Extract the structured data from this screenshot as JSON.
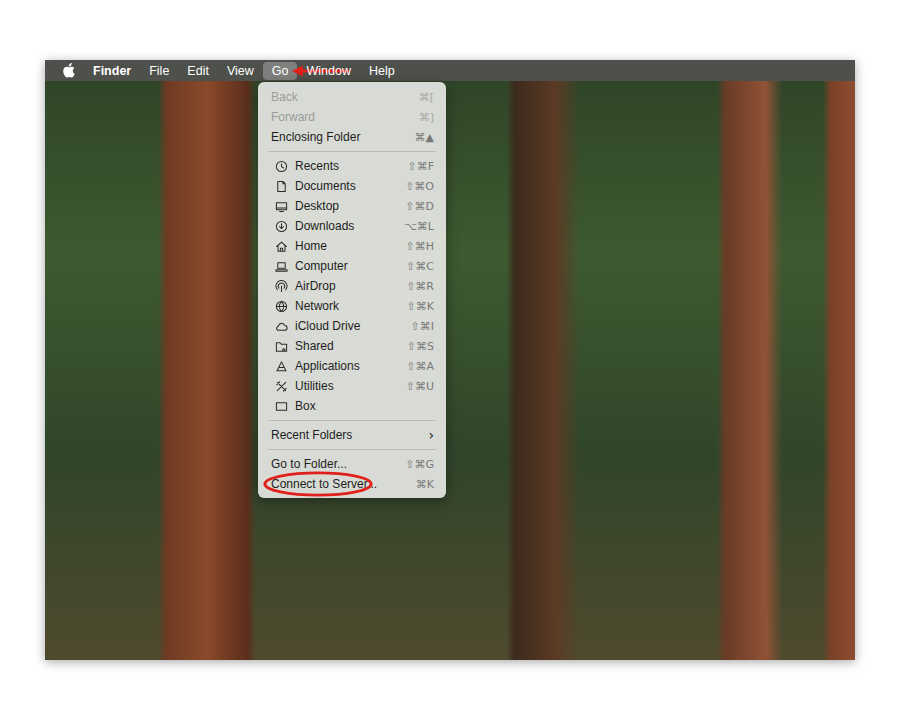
{
  "menu_bar": {
    "items": [
      {
        "label": "Finder",
        "kind": "app",
        "selected": false,
        "annotated": false
      },
      {
        "label": "File",
        "kind": "menu",
        "selected": false,
        "annotated": false
      },
      {
        "label": "Edit",
        "kind": "menu",
        "selected": false,
        "annotated": false
      },
      {
        "label": "View",
        "kind": "menu",
        "selected": false,
        "annotated": false
      },
      {
        "label": "Go",
        "kind": "menu",
        "selected": true,
        "annotated": true
      },
      {
        "label": "Window",
        "kind": "menu",
        "selected": false,
        "annotated": false
      },
      {
        "label": "Help",
        "kind": "menu",
        "selected": false,
        "annotated": false
      }
    ]
  },
  "menu": {
    "groups": [
      {
        "items": [
          {
            "label": "Back",
            "shortcut": "⌘[",
            "kind": "plain",
            "disabled": true,
            "circled": false
          },
          {
            "label": "Forward",
            "shortcut": "⌘]",
            "kind": "plain",
            "disabled": true,
            "circled": false
          },
          {
            "label": "Enclosing Folder",
            "shortcut": "⌘▲",
            "kind": "plain",
            "disabled": false,
            "circled": false
          }
        ]
      },
      {
        "items": [
          {
            "label": "Recents",
            "shortcut": "⇧⌘F",
            "kind": "place",
            "disabled": false,
            "circled": false
          },
          {
            "label": "Documents",
            "shortcut": "⇧⌘O",
            "kind": "place",
            "disabled": false,
            "circled": false
          },
          {
            "label": "Desktop",
            "shortcut": "⇧⌘D",
            "kind": "place",
            "disabled": false,
            "circled": false
          },
          {
            "label": "Downloads",
            "shortcut": "⌥⌘L",
            "kind": "place",
            "disabled": false,
            "circled": false
          },
          {
            "label": "Home",
            "shortcut": "⇧⌘H",
            "kind": "place",
            "disabled": false,
            "circled": false
          },
          {
            "label": "Computer",
            "shortcut": "⇧⌘C",
            "kind": "place",
            "disabled": false,
            "circled": false
          },
          {
            "label": "AirDrop",
            "shortcut": "⇧⌘R",
            "kind": "place",
            "disabled": false,
            "circled": false
          },
          {
            "label": "Network",
            "shortcut": "⇧⌘K",
            "kind": "place",
            "disabled": false,
            "circled": false
          },
          {
            "label": "iCloud Drive",
            "shortcut": "⇧⌘I",
            "kind": "place",
            "disabled": false,
            "circled": false
          },
          {
            "label": "Shared",
            "shortcut": "⇧⌘S",
            "kind": "place",
            "disabled": false,
            "circled": false
          },
          {
            "label": "Applications",
            "shortcut": "⇧⌘A",
            "kind": "place",
            "disabled": false,
            "circled": false
          },
          {
            "label": "Utilities",
            "shortcut": "⇧⌘U",
            "kind": "place",
            "disabled": false,
            "circled": false
          },
          {
            "label": "Box",
            "shortcut": "",
            "kind": "place",
            "disabled": false,
            "circled": false
          }
        ]
      },
      {
        "items": [
          {
            "label": "Recent Folders",
            "shortcut": "›",
            "kind": "submenu",
            "disabled": false,
            "circled": false
          }
        ]
      },
      {
        "items": [
          {
            "label": "Go to Folder...",
            "shortcut": "⇧⌘G",
            "kind": "plain",
            "disabled": false,
            "circled": false
          },
          {
            "label": "Connect to Server...",
            "shortcut": "⌘K",
            "kind": "plain",
            "disabled": false,
            "circled": true
          }
        ]
      }
    ]
  }
}
